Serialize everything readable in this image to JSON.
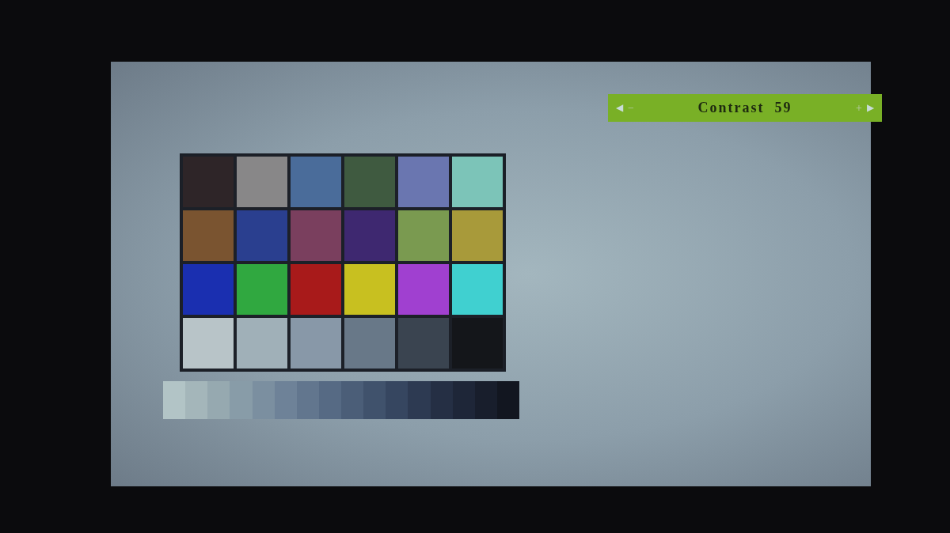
{
  "osd": {
    "left_arrow": "◀",
    "minus": "−",
    "label": "Contrast",
    "value": "59",
    "plus": "+",
    "right_arrow": "▶"
  },
  "color_chart": {
    "rows": [
      {
        "swatches": [
          {
            "color": "#2e2528"
          },
          {
            "color": "#888788"
          },
          {
            "color": "#4a6c9a"
          },
          {
            "color": "#3f5a40"
          },
          {
            "color": "#6a76b0"
          },
          {
            "color": "#7cc4b8"
          }
        ]
      },
      {
        "swatches": [
          {
            "color": "#7a5430"
          },
          {
            "color": "#2a3f8f"
          },
          {
            "color": "#7a3f5e"
          },
          {
            "color": "#3e2870"
          },
          {
            "color": "#7a9a50"
          },
          {
            "color": "#a89a3a"
          }
        ]
      },
      {
        "swatches": [
          {
            "color": "#1a2fb0"
          },
          {
            "color": "#30a840"
          },
          {
            "color": "#a81a1a"
          },
          {
            "color": "#c8c020"
          },
          {
            "color": "#a040d0"
          },
          {
            "color": "#40d0d0"
          }
        ]
      },
      {
        "swatches": [
          {
            "color": "#b8c4c8"
          },
          {
            "color": "#a0b0b8"
          },
          {
            "color": "#8898a8"
          },
          {
            "color": "#687888"
          },
          {
            "color": "#3a4450"
          },
          {
            "color": "#14161a"
          }
        ]
      }
    ]
  },
  "gray_scale": [
    {
      "color": "#b2c4c6"
    },
    {
      "color": "#a4b6ba"
    },
    {
      "color": "#96a9b0"
    },
    {
      "color": "#889ca8"
    },
    {
      "color": "#7b8fa0"
    },
    {
      "color": "#6e8298"
    },
    {
      "color": "#62768e"
    },
    {
      "color": "#566a84"
    },
    {
      "color": "#4b5e78"
    },
    {
      "color": "#40526c"
    },
    {
      "color": "#364660"
    },
    {
      "color": "#2d3a52"
    },
    {
      "color": "#252f44"
    },
    {
      "color": "#1e2638"
    },
    {
      "color": "#181e2c"
    },
    {
      "color": "#121620"
    }
  ]
}
